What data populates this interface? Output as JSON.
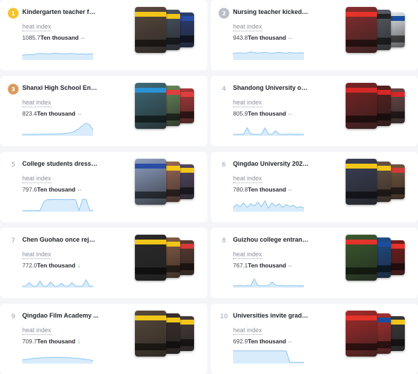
{
  "unit_label": "Ten thousand",
  "heat_index_label": "heat index",
  "colors": {
    "accent_line": "#8cc4f2",
    "accent_fill": "#d9ecfb",
    "trend_flat": "#aab0b8",
    "trend_down": "#4cae4c"
  },
  "items": [
    {
      "rank": "1",
      "medal": "gold",
      "title": "Kindergarten teacher fee...",
      "value": "1085.7",
      "trend": "--",
      "trend_type": "flat",
      "trend_icon": "dash-icon",
      "spark": [
        0.28,
        0.3,
        0.32,
        0.3,
        0.36,
        0.4,
        0.38,
        0.35,
        0.37,
        0.42,
        0.4,
        0.38,
        0.36,
        0.38,
        0.4,
        0.36,
        0.35,
        0.37,
        0.34,
        0.36,
        0.38
      ],
      "thumb_colors": [
        "#5b4a3e",
        "#4a5563",
        "#2d3f78"
      ],
      "thumb_bands": [
        "#f2c618",
        "#f2c618",
        "#2a4da5"
      ]
    },
    {
      "rank": "2",
      "medal": "silver",
      "title": "Nursing teacher kicked s...",
      "value": "943.8",
      "trend": "--",
      "trend_type": "flat",
      "trend_icon": "dash-icon",
      "spark": [
        0.4,
        0.42,
        0.44,
        0.41,
        0.43,
        0.5,
        0.46,
        0.42,
        0.44,
        0.47,
        0.43,
        0.41,
        0.44,
        0.46,
        0.43,
        0.42,
        0.45,
        0.43,
        0.42,
        0.44,
        0.43
      ],
      "thumb_colors": [
        "#8a2e2e",
        "#5a5f66",
        "#e9eef3"
      ],
      "thumb_bands": [
        "#e4332b",
        "#222222",
        "#1c4ea0"
      ]
    },
    {
      "rank": "3",
      "medal": "bronze",
      "title": "Shanxi High School Entr...",
      "value": "823.4",
      "trend": "--",
      "trend_type": "flat",
      "trend_icon": "dash-icon",
      "spark": [
        0.04,
        0.05,
        0.05,
        0.06,
        0.05,
        0.06,
        0.07,
        0.06,
        0.07,
        0.08,
        0.08,
        0.1,
        0.12,
        0.14,
        0.2,
        0.3,
        0.45,
        0.65,
        0.82,
        0.7,
        0.35
      ],
      "thumb_colors": [
        "#3f6b78",
        "#6a8a5c",
        "#b53a3a"
      ],
      "thumb_bands": [
        "#2a93d5",
        "#e03e3e",
        "#e03e3e"
      ]
    },
    {
      "rank": "4",
      "medal": "",
      "title": "Shandong University of ...",
      "value": "805.9",
      "trend": "--",
      "trend_type": "flat",
      "trend_icon": "dash-icon",
      "spark": [
        0.05,
        0.05,
        0.06,
        0.05,
        0.5,
        0.08,
        0.06,
        0.05,
        0.06,
        0.5,
        0.07,
        0.05,
        0.3,
        0.06,
        0.05,
        0.06,
        0.07,
        0.05,
        0.06,
        0.05,
        0.05
      ],
      "thumb_colors": [
        "#7a2323",
        "#5a1f1f",
        "#6e4a4a"
      ],
      "thumb_bands": [
        "#d42828",
        "#d42828",
        "#d42828"
      ]
    },
    {
      "rank": "5",
      "medal": "",
      "title": "College students dress u...",
      "value": "797.6",
      "trend": "--",
      "trend_type": "flat",
      "trend_icon": "dash-icon",
      "spark": [
        0.02,
        0.02,
        0.03,
        0.02,
        0.03,
        0.02,
        0.6,
        0.78,
        0.78,
        0.79,
        0.78,
        0.79,
        0.78,
        0.78,
        0.79,
        0.78,
        0.05,
        0.8,
        0.8,
        0.06,
        0.04
      ],
      "thumb_colors": [
        "#8ea0c2",
        "#9f6a5a",
        "#584a66"
      ],
      "thumb_bands": [
        "#2a4da5",
        "#f2c618",
        "#f2c618"
      ]
    },
    {
      "rank": "6",
      "medal": "",
      "title": "Qingdao University 2023...",
      "value": "780.8",
      "trend": "--",
      "trend_type": "flat",
      "trend_icon": "dash-icon",
      "spark": [
        0.2,
        0.45,
        0.3,
        0.55,
        0.25,
        0.5,
        0.35,
        0.6,
        0.3,
        0.7,
        0.2,
        0.55,
        0.35,
        0.5,
        0.25,
        0.45,
        0.3,
        0.4,
        0.22,
        0.3,
        0.2
      ],
      "thumb_colors": [
        "#3a3f55",
        "#6b5546",
        "#7a5a40"
      ],
      "thumb_bands": [
        "#f2c618",
        "#f2c618",
        "#d43a3a"
      ]
    },
    {
      "rank": "7",
      "medal": "",
      "title": "Chen Guohao once reject...",
      "value": "772.0",
      "trend": "↓",
      "trend_type": "down",
      "trend_icon": "arrow-down-icon",
      "spark": [
        0.05,
        0.06,
        0.3,
        0.06,
        0.05,
        0.4,
        0.06,
        0.05,
        0.35,
        0.06,
        0.05,
        0.25,
        0.06,
        0.05,
        0.3,
        0.06,
        0.05,
        0.06,
        0.5,
        0.05,
        0.05
      ],
      "thumb_colors": [
        "#2a2a2a",
        "#8a6048",
        "#5e3c30"
      ],
      "thumb_bands": [
        "#f2c618",
        "#f2c618",
        "#d43a3a"
      ]
    },
    {
      "rank": "8",
      "medal": "",
      "title": "Guizhou college entranc...",
      "value": "767.1",
      "trend": "--",
      "trend_type": "flat",
      "trend_icon": "dash-icon",
      "spark": [
        0.08,
        0.08,
        0.09,
        0.08,
        0.1,
        0.09,
        0.55,
        0.1,
        0.08,
        0.09,
        0.1,
        0.35,
        0.12,
        0.09,
        0.1,
        0.08,
        0.09,
        0.1,
        0.08,
        0.09,
        0.08
      ],
      "thumb_colors": [
        "#3b5a2e",
        "#1f4f8f",
        "#7a1c1c"
      ],
      "thumb_bands": [
        "#e4332b",
        "#1c4ea0",
        "#e4332b"
      ]
    },
    {
      "rank": "9",
      "medal": "",
      "title": "Qingdao Film Academy ...",
      "value": "709.7",
      "trend": "↓",
      "trend_type": "down",
      "trend_icon": "arrow-down-icon",
      "spark": [
        0.2,
        0.24,
        0.26,
        0.3,
        0.32,
        0.34,
        0.35,
        0.36,
        0.36,
        0.37,
        0.37,
        0.36,
        0.36,
        0.35,
        0.34,
        0.32,
        0.3,
        0.27,
        0.24,
        0.2,
        0.16
      ],
      "thumb_colors": [
        "#5a4a3a",
        "#3a2f2a",
        "#4a3c3a"
      ],
      "thumb_bands": [
        "#f2c618",
        "#f2c618",
        "#f2c618"
      ]
    },
    {
      "rank": "10",
      "medal": "",
      "title": "Universities invite gradu...",
      "value": "692.9",
      "trend": "--",
      "trend_type": "flat",
      "trend_icon": "dash-icon",
      "spark": [
        0.82,
        0.82,
        0.82,
        0.82,
        0.82,
        0.82,
        0.82,
        0.82,
        0.82,
        0.82,
        0.82,
        0.82,
        0.82,
        0.82,
        0.82,
        0.82,
        0.05,
        0.04,
        0.04,
        0.04,
        0.04
      ],
      "thumb_colors": [
        "#a52a2a",
        "#b03030",
        "#3a3a3a"
      ],
      "thumb_bands": [
        "#e4332b",
        "#1c4ea0",
        "#f2c618"
      ]
    }
  ]
}
